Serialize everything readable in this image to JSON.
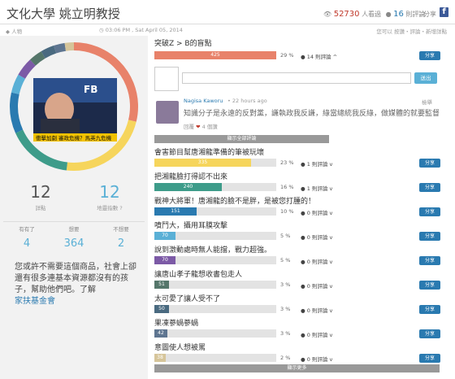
{
  "header": {
    "title": "文化大學 姚立明教授",
    "views": "52730",
    "views_label": "人看過",
    "comments": "16",
    "comments_label": "則評論",
    "share_label": "分享",
    "fb_icon": "f"
  },
  "subbar": {
    "tag": "人物",
    "date": "03:06 PM , Sat April 05, 2014",
    "links": "您可以 按讚・評論・新增詳點"
  },
  "left": {
    "points_count": "12",
    "points_label": "詳點",
    "map_count": "12",
    "map_label": "地靈指數 ?",
    "votes": [
      {
        "label": "有有了",
        "value": "4"
      },
      {
        "label": "想要",
        "value": "364"
      },
      {
        "label": "不想要",
        "value": "2"
      }
    ],
    "note": "您或許不需要這個商品，社會上卻還有很多連基本資源都沒有的孩子，幫助他們吧。了解",
    "note_link": "家扶基金會",
    "photo_caption": "衝擊加劇 審政危機？馬英九危機"
  },
  "top_point": {
    "title": "突破Z > B的盲點",
    "count": "425",
    "pct": "29 %",
    "comments": "14 則評論",
    "share": "分享"
  },
  "comment_form": {
    "send": "送出"
  },
  "comment": {
    "name": "Nagisa Kaworu",
    "time": "22 hours ago",
    "report": "檢舉",
    "text": "知識分子是永遠的反對黨，謙執政我反謙，綠當總統我反綠，做媒體的就要監督",
    "reply": "回覆",
    "likes": "4 個讚"
  },
  "show_all": "顯示全部評論",
  "show_more": "顯示更多",
  "points": [
    {
      "title": "會害節目幫唐湘龍準備的筆被玩壞",
      "count": "335",
      "pct": "23 %",
      "comments": "1 則評論",
      "color": "#f6d55c",
      "frac": 0.23
    },
    {
      "title": "把湘龍臉打得認不出來",
      "count": "240",
      "pct": "16 %",
      "comments": "1 則評論",
      "color": "#3e9c8a",
      "frac": 0.16
    },
    {
      "title": "戰神大將軍！唐湘龍的臉不是胖，是被您打腫的！",
      "count": "151",
      "pct": "10 %",
      "comments": "0 則評論",
      "color": "#2a7ab0",
      "frac": 0.1
    },
    {
      "title": "噴鬥大，攝用耳膜攻擊",
      "count": "70",
      "pct": "5 %",
      "comments": "0 則評論",
      "color": "#5ab0d6",
      "frac": 0.05
    },
    {
      "title": "說到激動處時無人能擋，戰力超強。",
      "count": "70",
      "pct": "5 %",
      "comments": "0 則評論",
      "color": "#7c5aa6",
      "frac": 0.05
    },
    {
      "title": "讓唐山孝子龍想收書包走人",
      "count": "51",
      "pct": "3 %",
      "comments": "0 則評論",
      "color": "#55766a",
      "frac": 0.035
    },
    {
      "title": "太可愛了讓人受不了",
      "count": "50",
      "pct": "3 %",
      "comments": "0 則評論",
      "color": "#4a6a80",
      "frac": 0.035
    },
    {
      "title": "果凍蔘蝸蔘蝸",
      "count": "42",
      "pct": "3 %",
      "comments": "0 則評論",
      "color": "#5e7590",
      "frac": 0.03
    },
    {
      "title": "意圖使人想被罵",
      "count": "38",
      "pct": "2 %",
      "comments": "0 則評論",
      "color": "#d6c59a",
      "frac": 0.026
    }
  ],
  "colors": {
    "top_bar": "#e8826a",
    "share_btn": "#2a7ab0"
  }
}
